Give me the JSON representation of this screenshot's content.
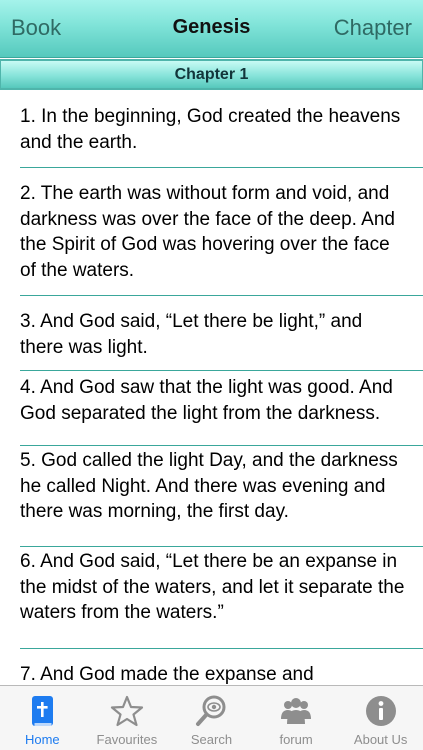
{
  "navbar": {
    "left_label": "Book",
    "title": "Genesis",
    "right_label": "Chapter"
  },
  "chapter_header": "Chapter 1",
  "verses": [
    "1. In the beginning, God created the heavens and the earth.",
    "2. The earth was without form and void, and darkness was over the face of the deep. And the Spirit of God was hovering over the face of the waters.",
    "3. And God said, “Let there be light,” and there was light.",
    "4. And God saw that the light was good. And God separated the light from the darkness.",
    "5. God called the light Day, and the darkness he called Night. And there was evening and there was morning, the first day.",
    "6. And God said, “Let there be an expanse in the midst of the waters, and let it separate the waters from the waters.”",
    "7. And God made the expanse and"
  ],
  "tabs": [
    {
      "label": "Home",
      "icon": "bible-icon",
      "active": true
    },
    {
      "label": "Favourites",
      "icon": "star-icon",
      "active": false
    },
    {
      "label": "Search",
      "icon": "magnifier-icon",
      "active": false
    },
    {
      "label": "forum",
      "icon": "people-icon",
      "active": false
    },
    {
      "label": "About Us",
      "icon": "info-icon",
      "active": false
    }
  ],
  "colors": {
    "accent": "#1e7cf0",
    "navbar_teal": "#7fe3d8",
    "divider": "#3aa79b",
    "inactive_tab": "#8e8e8e"
  }
}
